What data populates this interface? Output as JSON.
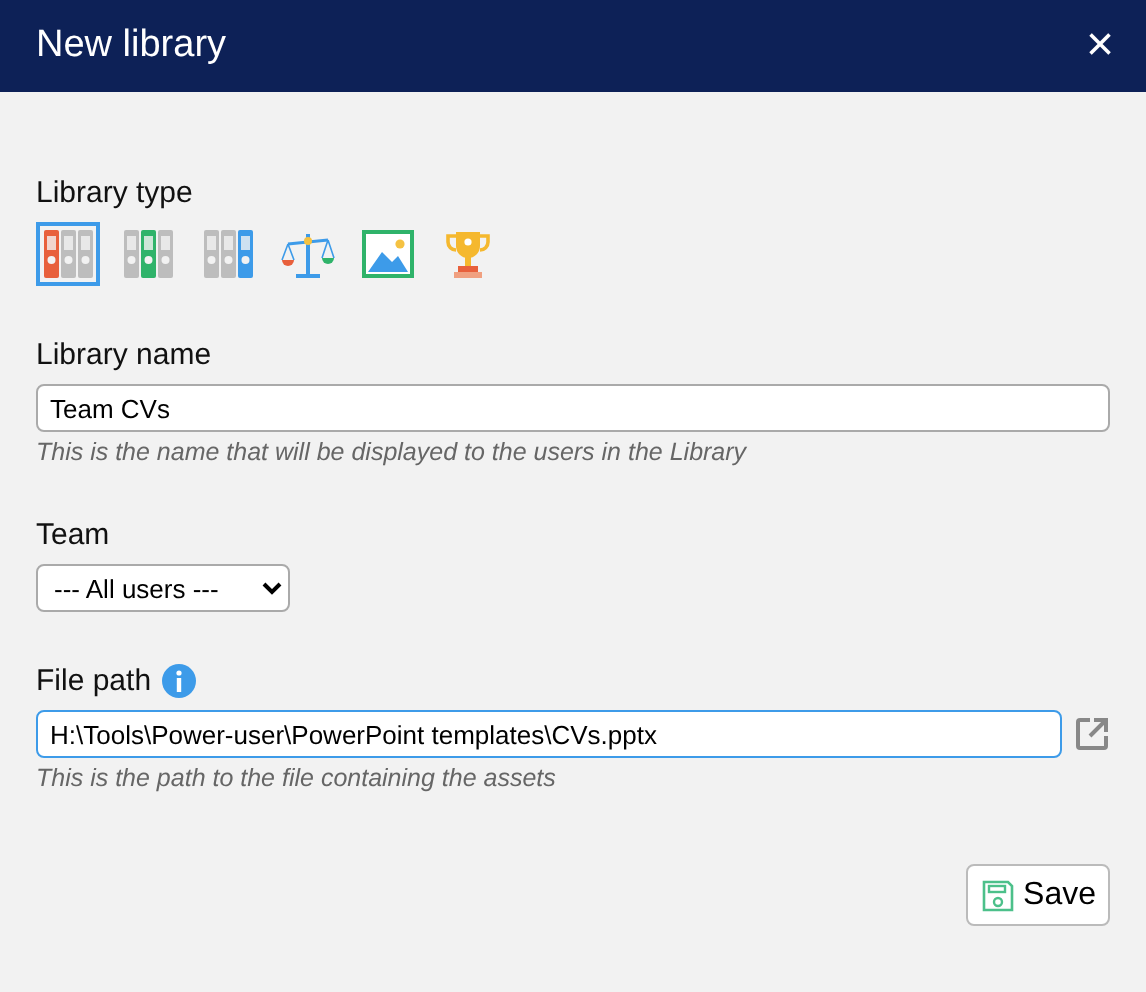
{
  "dialog": {
    "title": "New library",
    "close": "×"
  },
  "library_type": {
    "label": "Library type",
    "options": [
      {
        "kind": "binders_left",
        "color": "#e8603c",
        "selected": true
      },
      {
        "kind": "binders_middle",
        "color": "#2fb36a",
        "selected": false
      },
      {
        "kind": "binders_right",
        "color": "#3d9be9",
        "selected": false
      },
      {
        "kind": "scales",
        "selected": false
      },
      {
        "kind": "picture",
        "selected": false
      },
      {
        "kind": "trophy",
        "selected": false
      }
    ]
  },
  "library_name": {
    "label": "Library name",
    "value": "Team CVs",
    "hint": "This is the name that will be displayed to the users in the Library"
  },
  "team": {
    "label": "Team",
    "value": "--- All users ---"
  },
  "file_path": {
    "label": "File path",
    "value": "H:\\Tools\\Power-user\\PowerPoint templates\\CVs.pptx",
    "focused": true,
    "hint": "This is the path to the file containing the assets"
  },
  "save_button": {
    "label": "Save"
  }
}
